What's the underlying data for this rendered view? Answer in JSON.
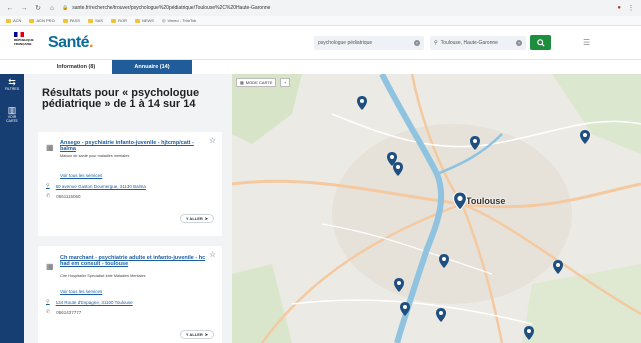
{
  "browser": {
    "url": "sante.fr/recherche/trouver/psychologue%20pédiatrique/Toulouse%2C%20Haute-Garonne",
    "bookmarks": [
      "ACN",
      "ACN PRO",
      "PASS",
      "SAS",
      "ROR",
      "NEWS",
      "Vimeo - TrimTok"
    ]
  },
  "header": {
    "gov_logo_text": "RÉPUBLIQUE FRANÇAISE",
    "brand": "Santé",
    "search_what": "psychologue pédiatrique",
    "search_where": "Toulouse, Haute-Garonne",
    "search_icon": "magnifier-icon",
    "menu_icon": "hamburger-icon"
  },
  "tabs": [
    {
      "label": "Information (8)",
      "active": false
    },
    {
      "label": "Annuaire (14)",
      "active": true
    }
  ],
  "rail": {
    "filter_label": "FILTRES",
    "map_label": "VOIR CARTE"
  },
  "results": {
    "title": "Résultats pour « psychologue pédiatrique » de 1 à 14 sur 14",
    "cards": [
      {
        "name": "Ansego - psychiatrie infanto-juvenile - hjtcmp/catt - balma",
        "type": "Maison de santé pour maladies mentales",
        "services_link": "Voir tous les services",
        "address": "60 avenue Gaston Doumergue, 31130 Balma",
        "phone": "0561115060",
        "go_label": "Y ALLER"
      },
      {
        "name": "Ch marchant - psychiatrie adulte et infanto-juvenile - hc had em consult - toulouse",
        "type": "Ctre Hospitalier Spécialisé lutte Maladies Mentales",
        "services_link": "Voir tous les services",
        "address": "134 Route d'Espagne, 31100 Toulouse",
        "phone": "0561437777",
        "go_label": "Y ALLER"
      }
    ]
  },
  "map": {
    "mode_label": "MODE CARTE",
    "city_label": "Toulouse",
    "colors": {
      "river": "#8fc3e0",
      "marker": "#1f4f80",
      "land": "#eceae4",
      "road": "#f5c9a0"
    }
  }
}
